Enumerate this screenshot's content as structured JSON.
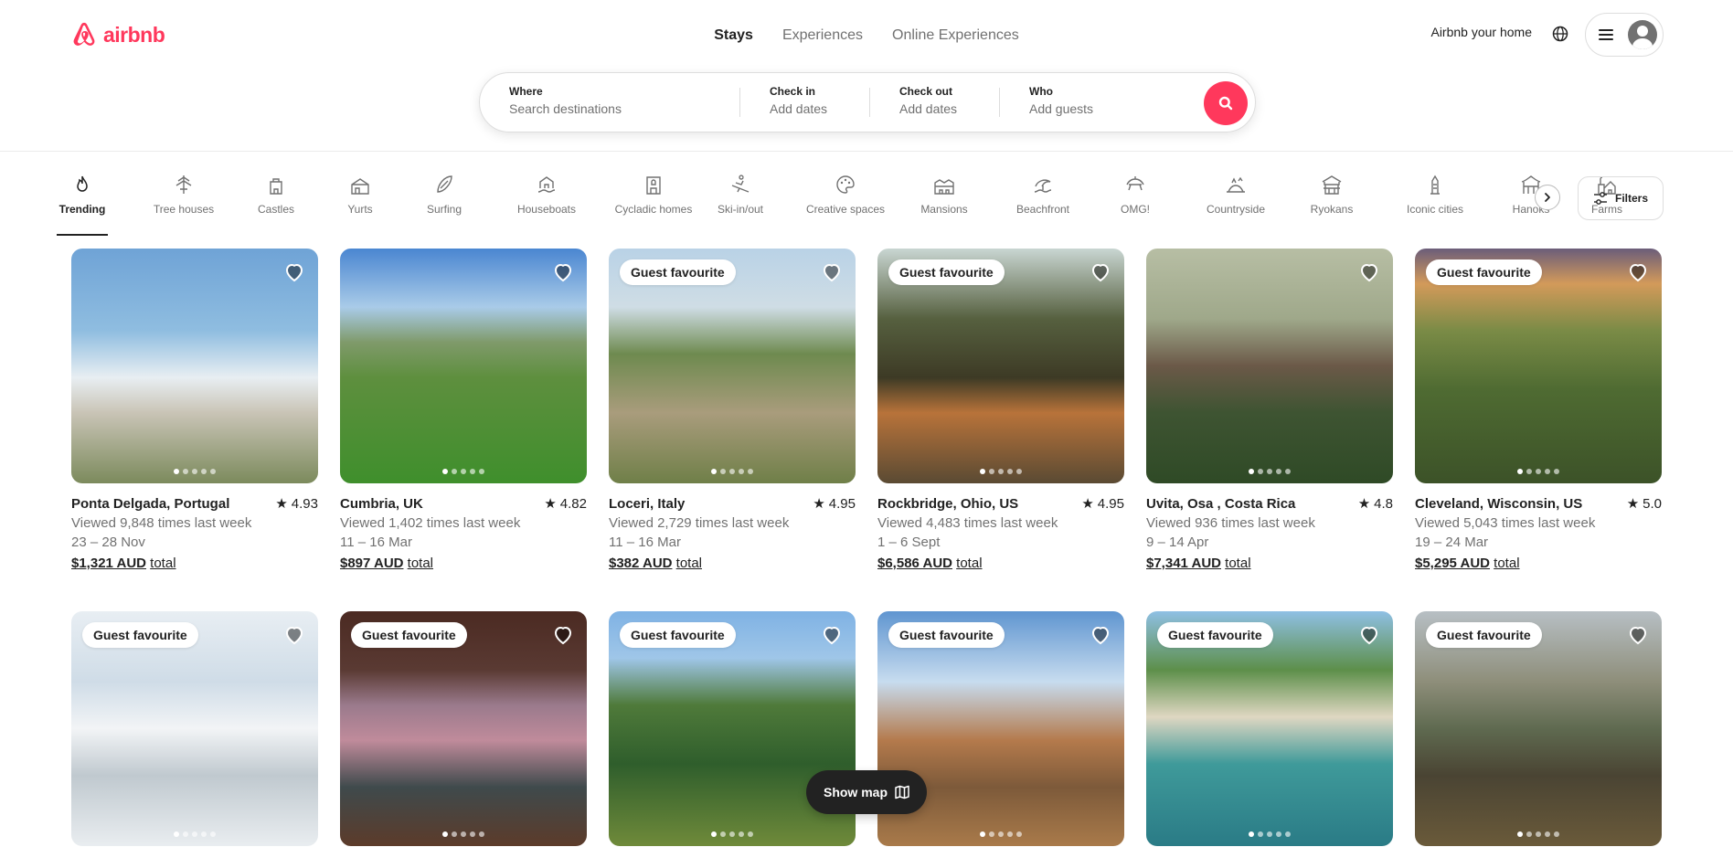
{
  "brand": {
    "name": "airbnb",
    "color": "#ff385c"
  },
  "nav": {
    "items": [
      {
        "label": "Stays",
        "active": true
      },
      {
        "label": "Experiences",
        "active": false
      },
      {
        "label": "Online Experiences",
        "active": false
      }
    ]
  },
  "header": {
    "host_link": "Airbnb your home",
    "globe_icon": "globe-icon",
    "menu_icon": "hamburger-icon"
  },
  "search": {
    "where": {
      "label": "Where",
      "placeholder": "Search destinations"
    },
    "checkin": {
      "label": "Check in",
      "placeholder": "Add dates"
    },
    "checkout": {
      "label": "Check out",
      "placeholder": "Add dates"
    },
    "who": {
      "label": "Who",
      "placeholder": "Add guests"
    },
    "button_icon": "search-icon"
  },
  "categories": [
    {
      "label": "Trending",
      "active": true
    },
    {
      "label": "Tree houses"
    },
    {
      "label": "Castles"
    },
    {
      "label": "Yurts"
    },
    {
      "label": "Surfing"
    },
    {
      "label": "Houseboats"
    },
    {
      "label": "Cycladic homes"
    },
    {
      "label": "Ski-in/out"
    },
    {
      "label": "Creative spaces"
    },
    {
      "label": "Mansions"
    },
    {
      "label": "Beachfront"
    },
    {
      "label": "OMG!"
    },
    {
      "label": "Countryside"
    },
    {
      "label": "Ryokans"
    },
    {
      "label": "Iconic cities"
    },
    {
      "label": "Hanoks"
    },
    {
      "label": "Farms"
    }
  ],
  "filters": {
    "label": "Filters"
  },
  "listings": [
    {
      "location": "Ponta Delgada, Portugal",
      "rating": "4.93",
      "views": "Viewed 9,848 times last week",
      "dates": "23 – 28 Nov",
      "price": "$1,321 AUD",
      "price_suffix": "total",
      "badge": ""
    },
    {
      "location": "Cumbria, UK",
      "rating": "4.82",
      "views": "Viewed 1,402 times last week",
      "dates": "11 – 16 Mar",
      "price": "$897 AUD",
      "price_suffix": "total",
      "badge": ""
    },
    {
      "location": "Loceri, Italy",
      "rating": "4.95",
      "views": "Viewed 2,729 times last week",
      "dates": "11 – 16 Mar",
      "price": "$382 AUD",
      "price_suffix": "total",
      "badge": "Guest favourite"
    },
    {
      "location": "Rockbridge, Ohio, US",
      "rating": "4.95",
      "views": "Viewed 4,483 times last week",
      "dates": "1 – 6 Sept",
      "price": "$6,586 AUD",
      "price_suffix": "total",
      "badge": "Guest favourite"
    },
    {
      "location": "Uvita, Osa , Costa Rica",
      "rating": "4.8",
      "views": "Viewed 936 times last week",
      "dates": "9 – 14 Apr",
      "price": "$7,341 AUD",
      "price_suffix": "total",
      "badge": ""
    },
    {
      "location": "Cleveland, Wisconsin, US",
      "rating": "5.0",
      "views": "Viewed 5,043 times last week",
      "dates": "19 – 24 Mar",
      "price": "$5,295 AUD",
      "price_suffix": "total",
      "badge": "Guest favourite"
    },
    {
      "badge": "Guest favourite"
    },
    {
      "badge": "Guest favourite"
    },
    {
      "badge": "Guest favourite"
    },
    {
      "badge": "Guest favourite"
    },
    {
      "badge": "Guest favourite"
    },
    {
      "badge": "Guest favourite"
    }
  ],
  "show_map": {
    "label": "Show map",
    "icon": "map-icon"
  }
}
